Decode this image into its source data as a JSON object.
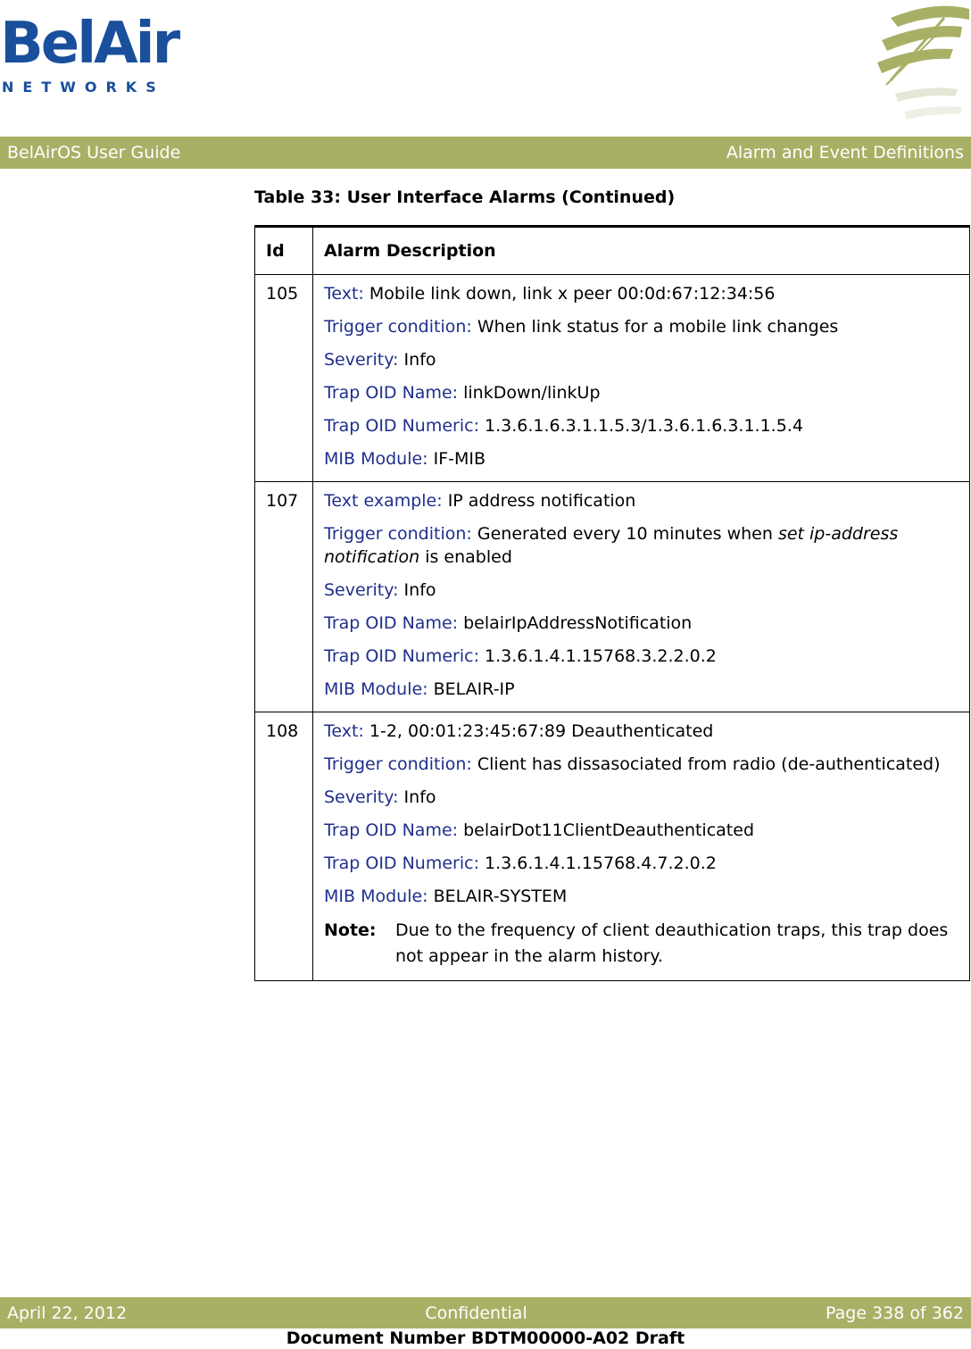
{
  "logo": {
    "brand": "BelAir",
    "sub": "NETWORKS"
  },
  "header": {
    "left": "BelAirOS User Guide",
    "right": "Alarm and Event Definitions"
  },
  "table": {
    "title": "Table 33: User Interface Alarms  (Continued)",
    "headers": [
      "Id",
      "Alarm Description"
    ],
    "rows": [
      {
        "id": "105",
        "fields": [
          {
            "label": "Text:",
            "value": "Mobile link down, link x peer 00:0d:67:12:34:56"
          },
          {
            "label": "Trigger condition:",
            "value": "When link status for a mobile link changes"
          },
          {
            "label": "Severity:",
            "value": "Info"
          },
          {
            "label": "Trap OID Name:",
            "value": "linkDown/linkUp"
          },
          {
            "label": "Trap OID Numeric:",
            "value": "1.3.6.1.6.3.1.1.5.3/1.3.6.1.6.3.1.1.5.4"
          },
          {
            "label": "MIB Module:",
            "value": "IF-MIB"
          }
        ]
      },
      {
        "id": "107",
        "fields": [
          {
            "label": "Text example:",
            "value": "IP address notification"
          },
          {
            "label": "Trigger condition:",
            "value_pre": "Generated every 10 minutes when ",
            "value_em": "set ip-address notification",
            "value_post": " is enabled"
          },
          {
            "label": "Severity:",
            "value": "Info"
          },
          {
            "label": "Trap OID Name:",
            "value": "belairIpAddressNotification"
          },
          {
            "label": "Trap OID Numeric:",
            "value": "1.3.6.1.4.1.15768.3.2.2.0.2"
          },
          {
            "label": "MIB Module:",
            "value": "BELAIR-IP"
          }
        ]
      },
      {
        "id": "108",
        "fields": [
          {
            "label": "Text:",
            "value": "1-2, 00:01:23:45:67:89 Deauthenticated"
          },
          {
            "label": "Trigger condition:",
            "value": "Client has dissasociated from radio (de-authenticated)"
          },
          {
            "label": "Severity:",
            "value": "Info"
          },
          {
            "label": "Trap OID Name:",
            "value": "belairDot11ClientDeauthenticated"
          },
          {
            "label": "Trap OID Numeric:",
            "value": "1.3.6.1.4.1.15768.4.7.2.0.2"
          },
          {
            "label": "MIB Module:",
            "value": "BELAIR-SYSTEM"
          }
        ],
        "note": {
          "label": "Note:",
          "value": "Due to the frequency of client deauthication traps, this trap does not appear in the alarm history."
        }
      }
    ]
  },
  "footer": {
    "left": "April 22, 2012",
    "center": "Confidential",
    "right": "Page 338 of 362"
  },
  "doc_number": "Document Number BDTM00000-A02 Draft",
  "colors": {
    "brand_blue": "#1a4f9c",
    "bar_green": "#a9b066",
    "label_blue": "#1f2f8c"
  }
}
